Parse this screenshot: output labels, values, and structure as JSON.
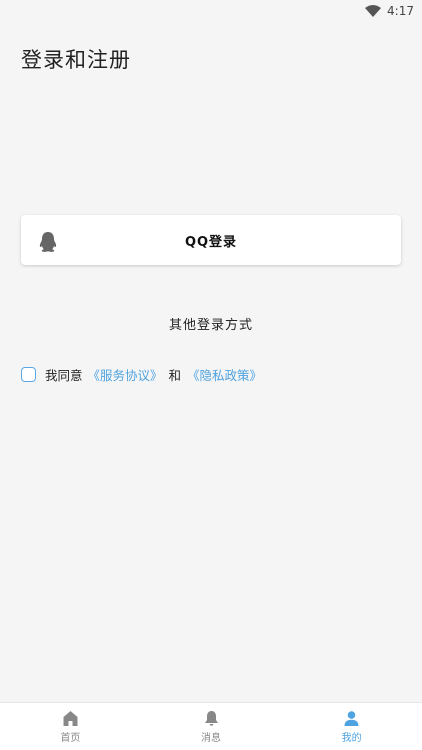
{
  "status_bar": {
    "time": "4:17",
    "wifi_icon": "wifi-icon"
  },
  "page": {
    "title": "登录和注册"
  },
  "qq_login": {
    "label": "QQ登录",
    "icon": "qq-penguin-icon"
  },
  "other_login": {
    "label": "其他登录方式"
  },
  "agreement": {
    "checked": false,
    "prefix": "我同意",
    "service_link": "《服务协议》",
    "and": "和",
    "privacy_link": "《隐私政策》",
    "link_color": "#4fa3e0"
  },
  "bottom_nav": {
    "items": [
      {
        "label": "首页",
        "icon": "home-icon",
        "active": false
      },
      {
        "label": "消息",
        "icon": "bell-icon",
        "active": false
      },
      {
        "label": "我的",
        "icon": "person-icon",
        "active": true
      }
    ],
    "active_color": "#4fa3e0"
  }
}
